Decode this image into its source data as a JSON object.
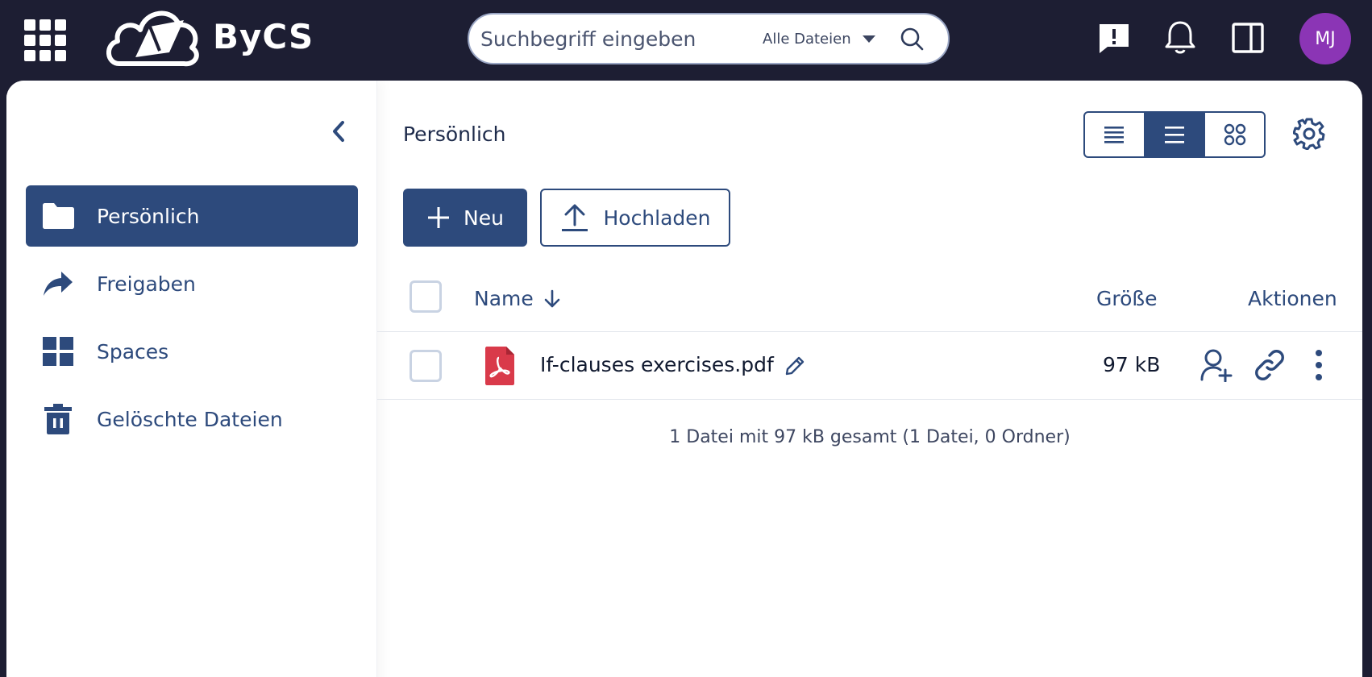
{
  "header": {
    "logo_text": "ByCS",
    "search_placeholder": "Suchbegriff eingeben",
    "search_scope": "Alle Dateien",
    "avatar_initials": "MJ"
  },
  "colors": {
    "topbar": "#1d1e33",
    "primary": "#2d4a7c",
    "avatar": "#8b35b5",
    "pdf": "#d93a4a"
  },
  "sidebar": {
    "items": [
      {
        "label": "Persönlich",
        "icon": "folder-icon",
        "active": true
      },
      {
        "label": "Freigaben",
        "icon": "share-icon",
        "active": false
      },
      {
        "label": "Spaces",
        "icon": "spaces-grid-icon",
        "active": false
      },
      {
        "label": "Gelöschte Dateien",
        "icon": "trash-icon",
        "active": false
      }
    ]
  },
  "main": {
    "breadcrumb": "Persönlich",
    "new_label": "Neu",
    "upload_label": "Hochladen",
    "columns": {
      "name": "Name",
      "size": "Größe",
      "actions": "Aktionen"
    },
    "files": [
      {
        "name": "If-clauses exercises.pdf",
        "size": "97 kB",
        "type": "pdf"
      }
    ],
    "summary": "1 Datei mit 97 kB gesamt (1 Datei, 0 Ordner)"
  }
}
